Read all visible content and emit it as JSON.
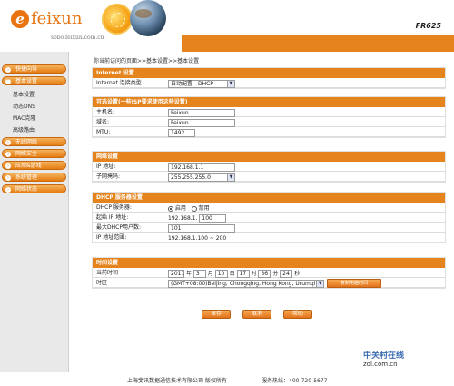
{
  "header": {
    "brand": "feixun",
    "url": "sobo.feixun.com.cn",
    "model": "FR625"
  },
  "nav": {
    "groups": [
      {
        "label": "快捷向导"
      },
      {
        "label": "基本设置"
      },
      {
        "label": "无线网络"
      },
      {
        "label": "网络安全"
      },
      {
        "label": "应用&游戏"
      },
      {
        "label": "系统管理"
      },
      {
        "label": "网络状态"
      }
    ],
    "sub_items": [
      {
        "label": "基本设置"
      },
      {
        "label": "动态DNS"
      },
      {
        "label": "MAC克隆"
      },
      {
        "label": "高级路由"
      }
    ]
  },
  "breadcrumb": "你当前访问的页面>>基本设置>>基本设置",
  "internet": {
    "title": "Internet 设置",
    "conn_type_label": "Internet 连接类型",
    "conn_type_value": "自动配置 - DHCP"
  },
  "optional": {
    "title": "可选设置(一些ISP要求使用这些设置)",
    "hostname_label": "主机名:",
    "hostname_value": "Feixun",
    "domain_label": "域名:",
    "domain_value": "Feixun",
    "mtu_label": "MTU:",
    "mtu_value": "1492"
  },
  "network": {
    "title": "网络设置",
    "ip_label": "IP 地址:",
    "ip_value": "192.168.1.1",
    "mask_label": "子网掩码:",
    "mask_value": "255.255.255.0"
  },
  "dhcp": {
    "title": "DHCP 服务器设置",
    "server_label": "DHCP 服务器:",
    "enable_label": "启用",
    "disable_label": "禁用",
    "start_label": "起始 IP 地址:",
    "start_prefix": "192.168.1.",
    "start_value": "100",
    "max_label": "最大DHCP用户数:",
    "max_value": "101",
    "range_label": "IP 地址范围:",
    "range_value": "192.168.1.100 ~ 200"
  },
  "time": {
    "title": "时间设置",
    "current_label": "当前时间",
    "year": "2011",
    "year_unit": "年",
    "month": "3",
    "month_unit": "月",
    "day": "10",
    "day_unit": "日",
    "hour": "17",
    "hour_unit": "时",
    "minute": "36",
    "minute_unit": "分",
    "second": "24",
    "second_unit": "秒",
    "tz_label": "时区",
    "tz_value": "(GMT+08:00)Beijing, Chongqing, Hong Kong, Urumqi",
    "sync_label": "复制电脑时间"
  },
  "actions": {
    "save": "保存",
    "cancel": "取消",
    "help": "帮助"
  },
  "footer": {
    "company": "上海斐讯数据通信技术有限公司     版权所有",
    "hotline": "服务热线：400-720-5677"
  },
  "watermark": {
    "cn": "中关村在线",
    "en": "zol.com.cn"
  },
  "colors": {
    "accent": "#e5841d"
  }
}
